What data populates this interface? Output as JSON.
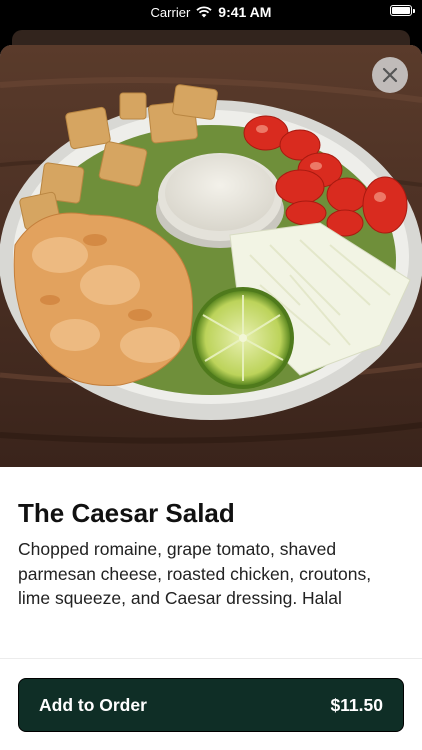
{
  "status_bar": {
    "carrier": "Carrier",
    "time": "9:41 AM"
  },
  "item": {
    "title": "The Caesar Salad",
    "description": "Chopped romaine, grape tomato, shaved parmesan cheese, roasted chicken, croutons, lime squeeze, and Caesar dressing. Halal"
  },
  "cta": {
    "label": "Add to Order",
    "price": "$11.50"
  },
  "colors": {
    "button_bg": "#0f2e26",
    "close_bg": "#d2d2d2"
  },
  "icons": {
    "close": "close-icon",
    "wifi": "wifi-icon",
    "battery": "battery-icon"
  }
}
